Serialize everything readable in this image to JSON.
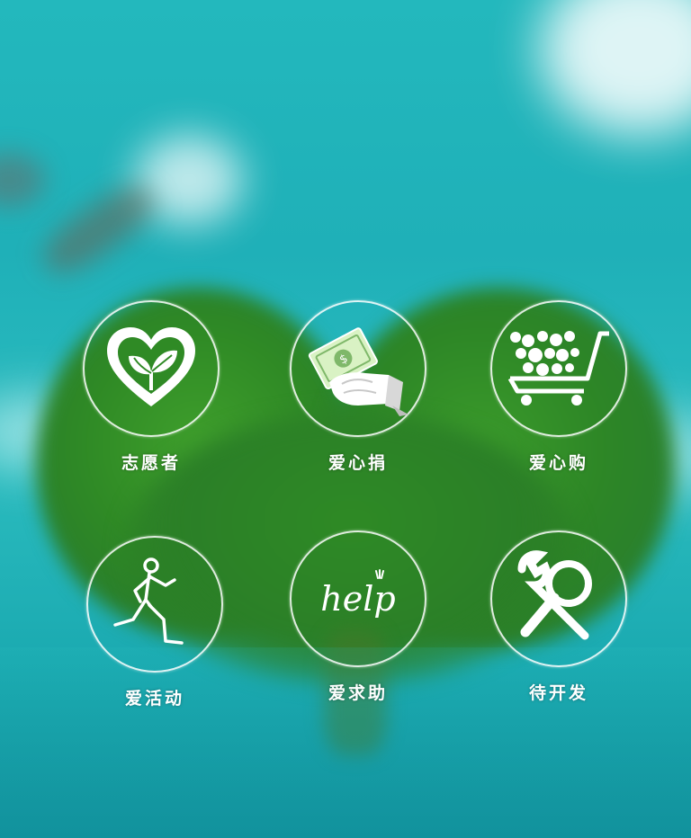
{
  "menu": {
    "items": [
      {
        "label": "志愿者",
        "icon": "heart-sprout-icon"
      },
      {
        "label": "爱心捐",
        "icon": "donate-hand-icon"
      },
      {
        "label": "爱心购",
        "icon": "shopping-cart-icon"
      },
      {
        "label": "爱活动",
        "icon": "runner-icon"
      },
      {
        "label": "爱求助",
        "icon": "help-icon",
        "icon_text": "help"
      },
      {
        "label": "待开发",
        "icon": "tools-icon"
      }
    ]
  },
  "colors": {
    "background": "#23b8bd",
    "icon": "#ffffff",
    "tree": "#2f8a25"
  }
}
